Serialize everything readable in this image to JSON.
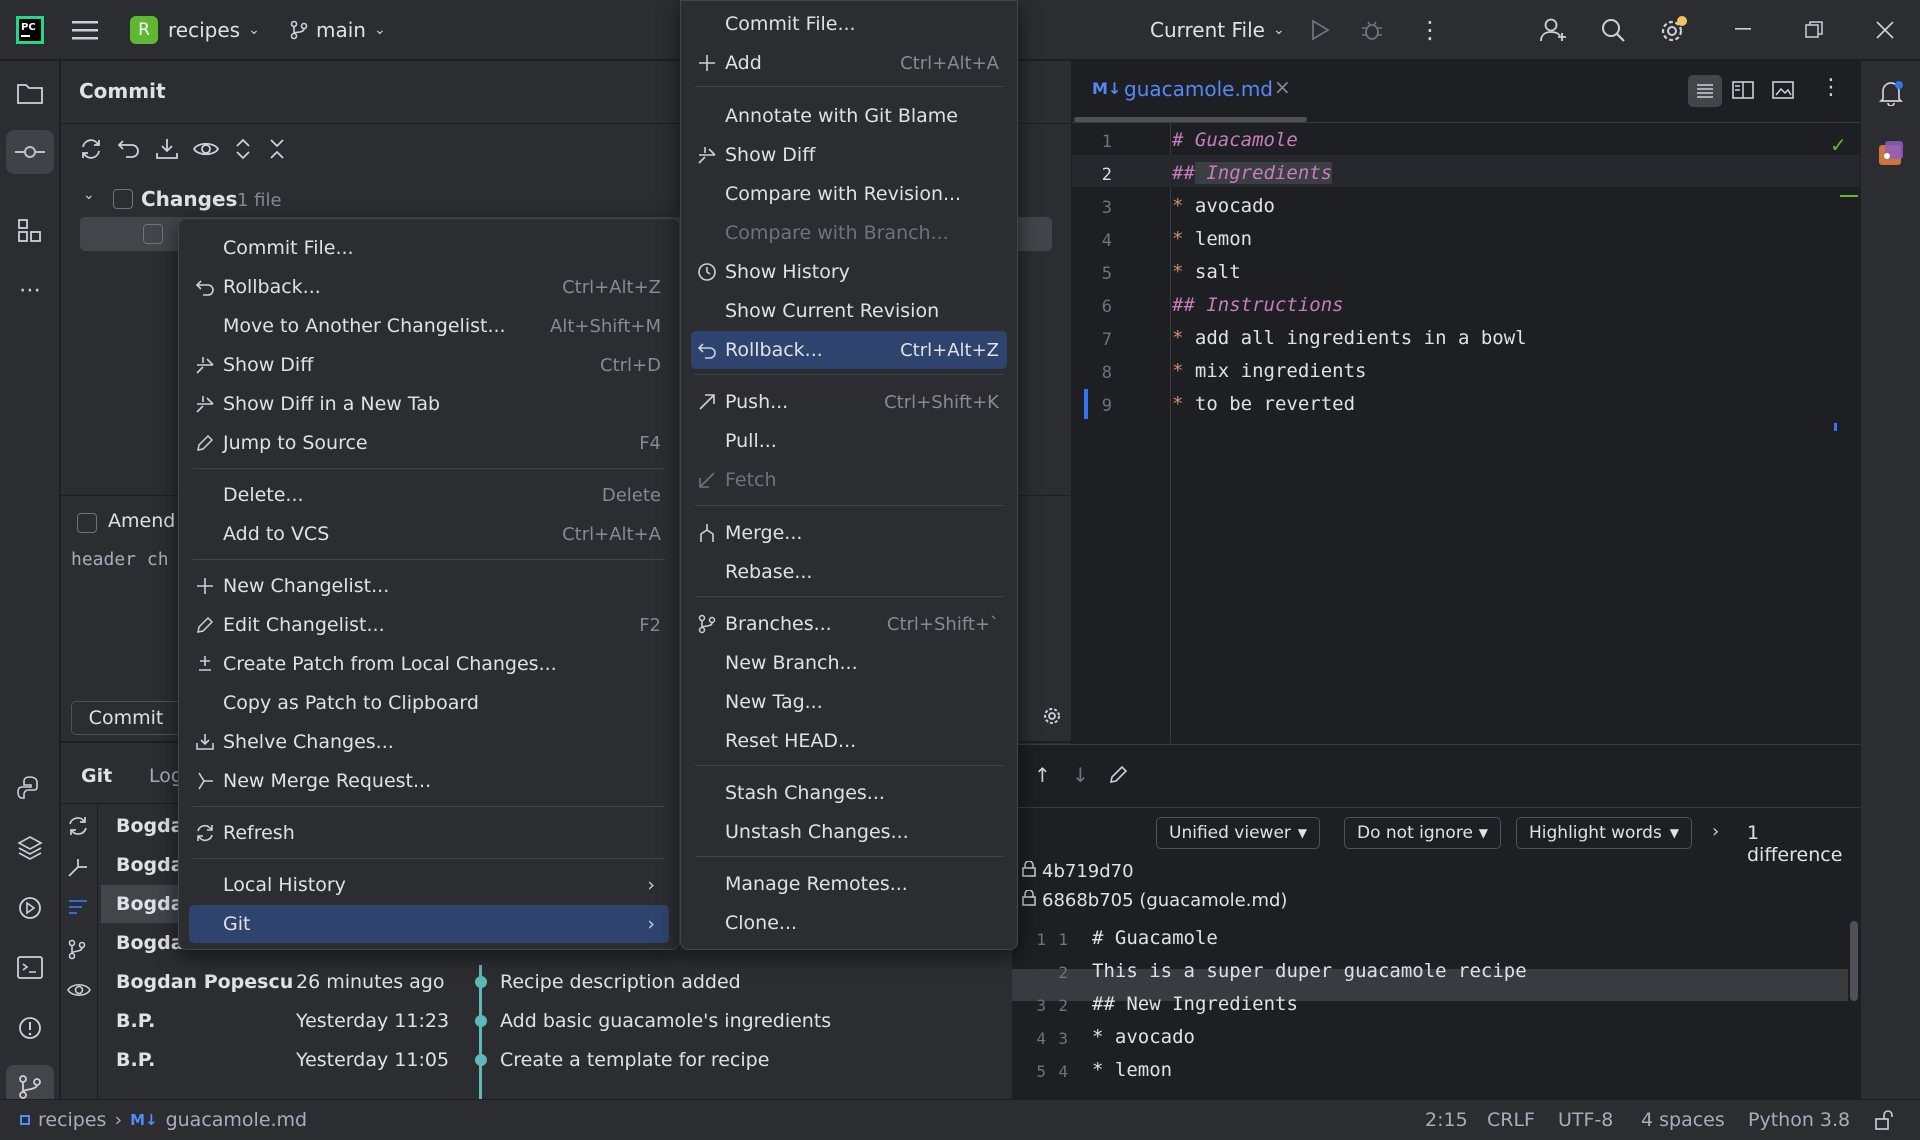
{
  "topbar": {
    "project_initial": "R",
    "project_name": "recipes",
    "branch": "main",
    "run_config": "Current File"
  },
  "colors": {
    "accent": "#2e436e",
    "project_badge": "#5fb832",
    "heading_purple": "#c77dbb",
    "bullet_orange": "#cf8e6d"
  },
  "commit_panel": {
    "title": "Commit",
    "changes_label": "Changes",
    "changes_count": "1 file",
    "amend_label": "Amend",
    "message_text": "header ch",
    "commit_button": "Commit"
  },
  "git_panel": {
    "tabs": [
      "Git",
      "Log"
    ],
    "commits": [
      {
        "author": "Bogda",
        "time": "",
        "message": ""
      },
      {
        "author": "Bogda",
        "time": "",
        "message": ""
      },
      {
        "author": "Bogda",
        "time": "",
        "message": ""
      },
      {
        "author": "Bogda",
        "time": "",
        "message": ""
      },
      {
        "author": "Bogdan Popescu",
        "time": "26 minutes ago",
        "message": "Recipe description added"
      },
      {
        "author": "B.P.",
        "time": "Yesterday 11:23",
        "message": "Add basic guacamole's ingredients"
      },
      {
        "author": "B.P.",
        "time": "Yesterday 11:05",
        "message": "Create a template for recipe"
      }
    ]
  },
  "context_menu": {
    "items": [
      {
        "label": "Commit File...",
        "shortcut": "",
        "icon": ""
      },
      {
        "label": "Rollback...",
        "shortcut": "Ctrl+Alt+Z",
        "icon": "rollback-icon"
      },
      {
        "label": "Move to Another Changelist...",
        "shortcut": "Alt+Shift+M",
        "icon": ""
      },
      {
        "label": "Show Diff",
        "shortcut": "Ctrl+D",
        "icon": "diff-icon"
      },
      {
        "label": "Show Diff in a New Tab",
        "shortcut": "",
        "icon": "diff-icon"
      },
      {
        "label": "Jump to Source",
        "shortcut": "F4",
        "icon": "edit-icon"
      },
      {
        "label": "Delete...",
        "shortcut": "Delete",
        "icon": ""
      },
      {
        "label": "Add to VCS",
        "shortcut": "Ctrl+Alt+A",
        "icon": ""
      },
      {
        "label": "New Changelist...",
        "shortcut": "",
        "icon": "plus-icon"
      },
      {
        "label": "Edit Changelist...",
        "shortcut": "F2",
        "icon": "edit-icon"
      },
      {
        "label": "Create Patch from Local Changes...",
        "shortcut": "",
        "icon": "patch-icon"
      },
      {
        "label": "Copy as Patch to Clipboard",
        "shortcut": "",
        "icon": ""
      },
      {
        "label": "Shelve Changes...",
        "shortcut": "",
        "icon": "shelve-icon"
      },
      {
        "label": "New Merge Request...",
        "shortcut": "",
        "icon": "merge-request-icon"
      },
      {
        "label": "Refresh",
        "shortcut": "",
        "icon": "refresh-icon"
      },
      {
        "label": "Local History",
        "shortcut": "",
        "icon": ""
      },
      {
        "label": "Git",
        "shortcut": "",
        "icon": ""
      }
    ]
  },
  "git_submenu": {
    "items": [
      {
        "label": "Commit File...",
        "shortcut": "",
        "icon": ""
      },
      {
        "label": "Add",
        "shortcut": "Ctrl+Alt+A",
        "icon": "plus-icon"
      },
      {
        "label": "Annotate with Git Blame",
        "shortcut": "",
        "icon": ""
      },
      {
        "label": "Show Diff",
        "shortcut": "",
        "icon": "diff-icon"
      },
      {
        "label": "Compare with Revision...",
        "shortcut": "",
        "icon": ""
      },
      {
        "label": "Compare with Branch...",
        "shortcut": "",
        "icon": ""
      },
      {
        "label": "Show History",
        "shortcut": "",
        "icon": "clock-icon"
      },
      {
        "label": "Show Current Revision",
        "shortcut": "",
        "icon": ""
      },
      {
        "label": "Rollback...",
        "shortcut": "Ctrl+Alt+Z",
        "icon": "rollback-icon"
      },
      {
        "label": "Push...",
        "shortcut": "Ctrl+Shift+K",
        "icon": "push-icon"
      },
      {
        "label": "Pull...",
        "shortcut": "",
        "icon": ""
      },
      {
        "label": "Fetch",
        "shortcut": "",
        "icon": "fetch-icon"
      },
      {
        "label": "Merge...",
        "shortcut": "",
        "icon": "merge-icon"
      },
      {
        "label": "Rebase...",
        "shortcut": "",
        "icon": ""
      },
      {
        "label": "Branches...",
        "shortcut": "Ctrl+Shift+`",
        "icon": "branch-icon"
      },
      {
        "label": "New Branch...",
        "shortcut": "",
        "icon": ""
      },
      {
        "label": "New Tag...",
        "shortcut": "",
        "icon": ""
      },
      {
        "label": "Reset HEAD...",
        "shortcut": "",
        "icon": ""
      },
      {
        "label": "Stash Changes...",
        "shortcut": "",
        "icon": ""
      },
      {
        "label": "Unstash Changes...",
        "shortcut": "",
        "icon": ""
      },
      {
        "label": "Manage Remotes...",
        "shortcut": "",
        "icon": ""
      },
      {
        "label": "Clone...",
        "shortcut": "",
        "icon": ""
      }
    ]
  },
  "editor": {
    "tab_title": "guacamole.md",
    "tab_badge": "M↓",
    "lines": [
      {
        "num": "1",
        "marker": "#",
        "text": " Guacamole"
      },
      {
        "num": "2",
        "marker": "##",
        "text": " Ingredients"
      },
      {
        "num": "3",
        "marker": "*",
        "text": " avocado"
      },
      {
        "num": "4",
        "marker": "*",
        "text": " lemon"
      },
      {
        "num": "5",
        "marker": "*",
        "text": " salt"
      },
      {
        "num": "6",
        "marker": "##",
        "text": " Instructions"
      },
      {
        "num": "7",
        "marker": "*",
        "text": " add all ingredients in a bowl"
      },
      {
        "num": "8",
        "marker": "*",
        "text": " mix ingredients"
      },
      {
        "num": "9",
        "marker": "*",
        "text": " to be reverted"
      }
    ]
  },
  "diff": {
    "viewer": "Unified viewer",
    "ignore": "Do not ignore",
    "highlight": "Highlight words",
    "count": "1 difference",
    "rev_left": "4b719d70",
    "rev_right": "6868b705 (guacamole.md)",
    "lines": [
      {
        "left": "1",
        "right": "1",
        "text": "# Guacamole"
      },
      {
        "left": "",
        "right": "2",
        "text": "This is a super duper guacamole recipe"
      },
      {
        "left": "3",
        "right": "2",
        "text": "## New Ingredients"
      },
      {
        "left": "4",
        "right": "3",
        "text": "* avocado"
      },
      {
        "left": "5",
        "right": "4",
        "text": "* lemon"
      }
    ]
  },
  "statusbar": {
    "project": "recipes",
    "file": "guacamole.md",
    "file_badge": "M↓",
    "position": "2:15",
    "line_sep": "CRLF",
    "encoding": "UTF-8",
    "indent": "4 spaces",
    "interpreter": "Python 3.8"
  }
}
